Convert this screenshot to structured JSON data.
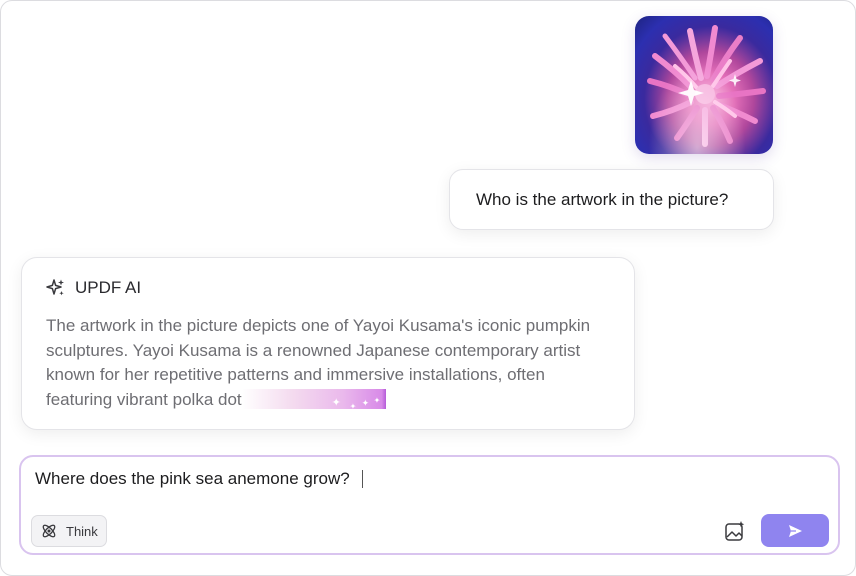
{
  "conversation": {
    "uploaded_image": {
      "icon": "pink-sea-anemone-photo"
    },
    "user_message": "Who is the artwork in the picture?",
    "ai_response": {
      "title": "UPDF AI",
      "icon": "sparkle-icon",
      "text": "The artwork in the picture depicts one of Yayoi Kusama's iconic pumpkin sculptures. Yayoi Kusama is a renowned Japanese contemporary artist known for her repetitive patterns and immersive installations, often featuring vibrant polka dot"
    }
  },
  "composer": {
    "value": "Where does the pink sea anemone grow?",
    "think_label": "Think",
    "think_icon": "atom-icon",
    "image_icon": "image-sparkle-icon",
    "send_icon": "send-icon"
  },
  "colors": {
    "accent": "#8f84ef",
    "input_border": "#d9c4ef",
    "muted_text": "#6e6e73"
  }
}
